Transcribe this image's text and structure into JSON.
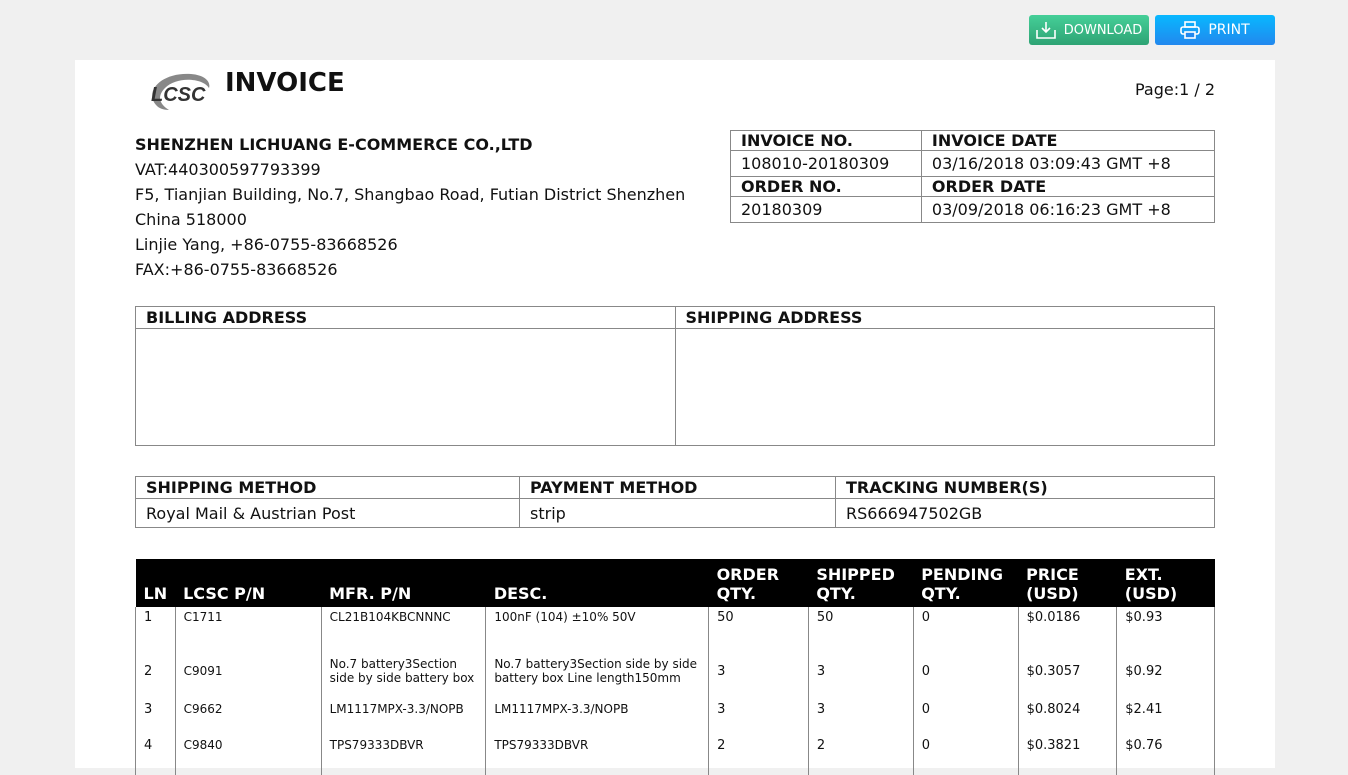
{
  "toolbar": {
    "download": "DOWNLOAD",
    "print": "PRINT"
  },
  "header": {
    "logo_text": "LCSC",
    "title": "INVOICE",
    "page": "Page:1 / 2"
  },
  "company": {
    "name": "SHENZHEN LICHUANG E-COMMERCE CO.,LTD",
    "vat": "VAT:440300597793399",
    "address1": "F5, Tianjian Building, No.7, Shangbao Road, Futian District Shenzhen",
    "address2": "China 518000",
    "contact": "Linjie Yang, +86-0755-83668526",
    "fax": "FAX:+86-0755-83668526"
  },
  "invoice": {
    "no_label": "INVOICE NO.",
    "no": "108010-20180309",
    "date_label": "INVOICE DATE",
    "date": "03/16/2018 03:09:43 GMT +8",
    "order_label": "ORDER NO.",
    "order": "20180309",
    "order_date_label": "ORDER DATE",
    "order_date": "03/09/2018 06:16:23 GMT +8"
  },
  "addresses": {
    "billing": "BILLING ADDRESS",
    "shipping": "SHIPPING ADDRESS"
  },
  "methods": {
    "shipping_label": "SHIPPING METHOD",
    "shipping": "Royal Mail & Austrian Post",
    "payment_label": "PAYMENT METHOD",
    "payment": "strip",
    "tracking_label": "TRACKING NUMBER(S)",
    "tracking": "RS666947502GB"
  },
  "items": {
    "headers": [
      "LN",
      "LCSC P/N",
      "MFR. P/N",
      "DESC.",
      "ORDER QTY.",
      "SHIPPED QTY.",
      "PENDING QTY.",
      "PRICE (USD)",
      "EXT. (USD)"
    ],
    "rows": [
      [
        "1",
        "C1711",
        "CL21B104KBCNNNC",
        "100nF (104) ±10% 50V",
        "50",
        "50",
        "0",
        "$0.0186",
        "$0.93"
      ],
      [
        "2",
        "C9091",
        "No.7 battery3Section side by side battery box",
        "No.7 battery3Section side by side battery box Line length150mm",
        "3",
        "3",
        "0",
        "$0.3057",
        "$0.92"
      ],
      [
        "3",
        "C9662",
        "LM1117MPX-3.3/NOPB",
        "LM1117MPX-3.3/NOPB",
        "3",
        "3",
        "0",
        "$0.8024",
        "$2.41"
      ],
      [
        "4",
        "C9840",
        "TPS79333DBVR",
        "TPS79333DBVR",
        "2",
        "2",
        "0",
        "$0.3821",
        "$0.76"
      ]
    ]
  }
}
